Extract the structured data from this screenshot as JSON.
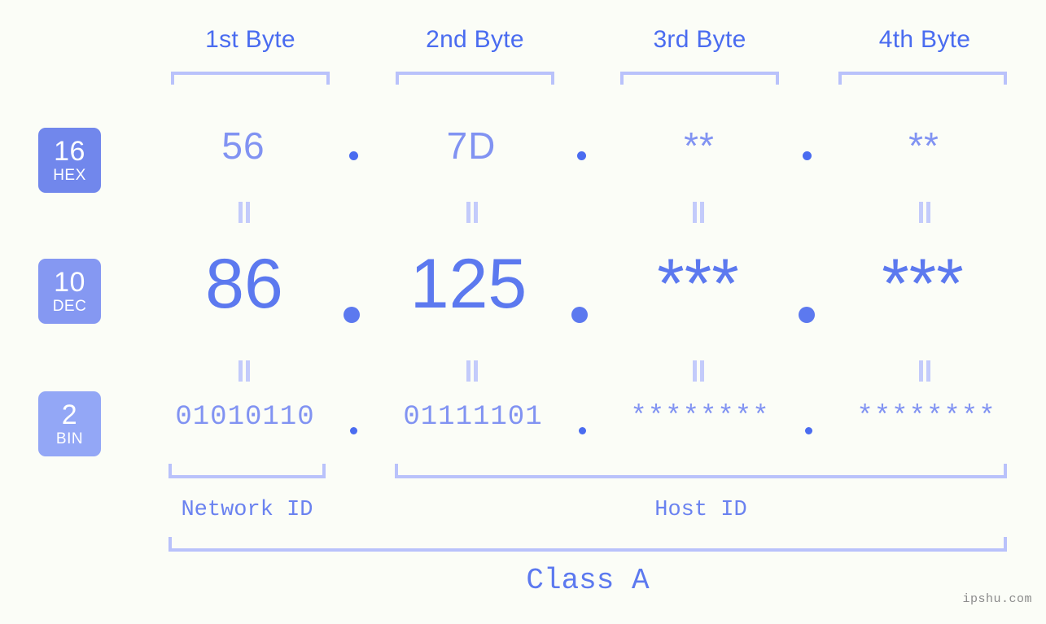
{
  "watermark": "ipshu.com",
  "byte_headers": [
    {
      "label": "1st Byte"
    },
    {
      "label": "2nd Byte"
    },
    {
      "label": "3rd Byte"
    },
    {
      "label": "4th Byte"
    }
  ],
  "bases": [
    {
      "id": "hex",
      "number": "16",
      "tag": "HEX",
      "color": "#7187ec"
    },
    {
      "id": "dec",
      "number": "10",
      "tag": "DEC",
      "color": "#8598f2"
    },
    {
      "id": "bin",
      "number": "2",
      "tag": "BIN",
      "color": "#93a7f6"
    }
  ],
  "rows": {
    "hex": {
      "values": [
        "56",
        "7D",
        "**",
        "**"
      ],
      "separator": "."
    },
    "dec": {
      "values": [
        "86",
        "125",
        "***",
        "***"
      ],
      "separator": "."
    },
    "bin": {
      "values": [
        "01010110",
        "01111101",
        "********",
        "********"
      ],
      "separator": "."
    }
  },
  "equality_symbol": "=",
  "sections": [
    {
      "label": "Network ID"
    },
    {
      "label": "Host ID"
    }
  ],
  "class": {
    "label": "Class A"
  },
  "colors": {
    "background": "#fbfdf7",
    "header_text": "#4a6cf0",
    "bracket": "#b9c2fb",
    "hex_value": "#8193f2",
    "dec_value": "#5c79ef",
    "bin_value": "#8193f2",
    "dot": "#4a6cf0",
    "equals": "#c3cbfb",
    "watermark": "#8b8b8b"
  }
}
